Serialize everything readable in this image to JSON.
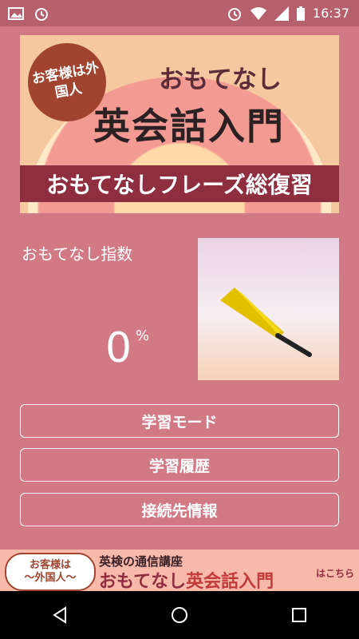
{
  "status_bar": {
    "time": "16:37",
    "icons": [
      "image-icon",
      "alarm-icon",
      "alarm-icon",
      "wifi-icon",
      "signal-icon",
      "battery-icon"
    ]
  },
  "banner": {
    "badge": "お客様は外国人",
    "top_text": "おもてなし",
    "main_text": "英会話入門",
    "ribbon_text": "おもてなしフレーズ総復習"
  },
  "score": {
    "label": "おもてなし指数",
    "value": "0",
    "unit": "%"
  },
  "buttons": {
    "study_mode": "学習モード",
    "study_history": "学習履歴",
    "connection_info": "接続先情報"
  },
  "ad": {
    "badge_line1": "お客様は",
    "badge_line2": "〜外国人〜",
    "line1": "英検の通信講座",
    "line2a": "おもてなし",
    "line2b": "英会話入門",
    "kochira": "はこちら"
  },
  "colors": {
    "background": "#d17a86",
    "status_bar": "#b5606c",
    "ribbon": "#8e2e3f"
  }
}
